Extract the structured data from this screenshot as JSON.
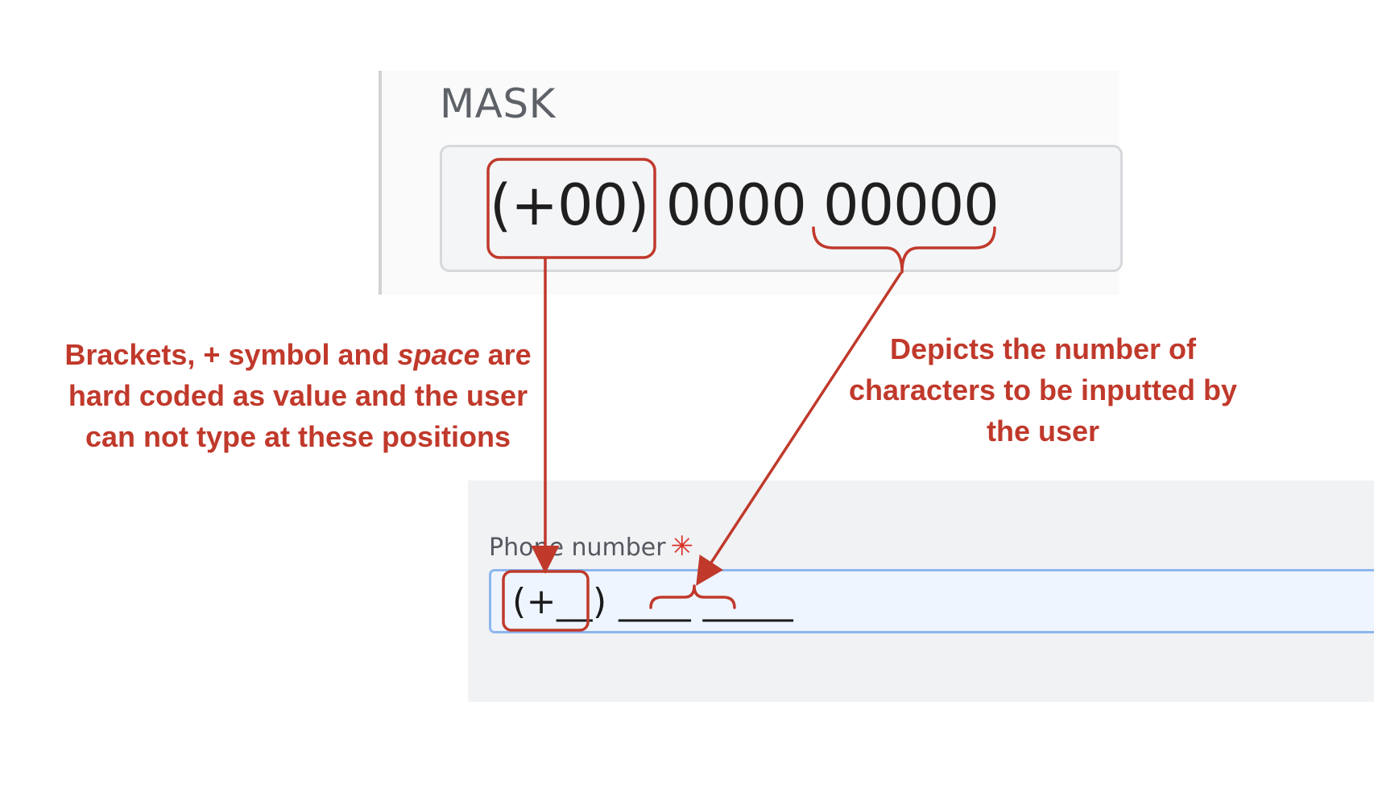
{
  "mask_panel": {
    "title": "MASK",
    "value_prefix": "(+00)",
    "value_middle": " 0000 ",
    "value_suffix": "00000"
  },
  "phone_form": {
    "label": "Phone number",
    "required_mark": "✳",
    "input_value": "(+__) ____ _____"
  },
  "annotations": {
    "left_note_part1": "Brackets, + symbol and ",
    "left_note_emphasis": "space",
    "left_note_part2": " are hard coded as value and the user can not type at these positions",
    "right_note": "Depicts the number of characters to be inputted by the user"
  },
  "colors": {
    "annotation_red": "#c0392b",
    "input_focus_border": "#8cb6ee",
    "required_red": "#d93025"
  }
}
